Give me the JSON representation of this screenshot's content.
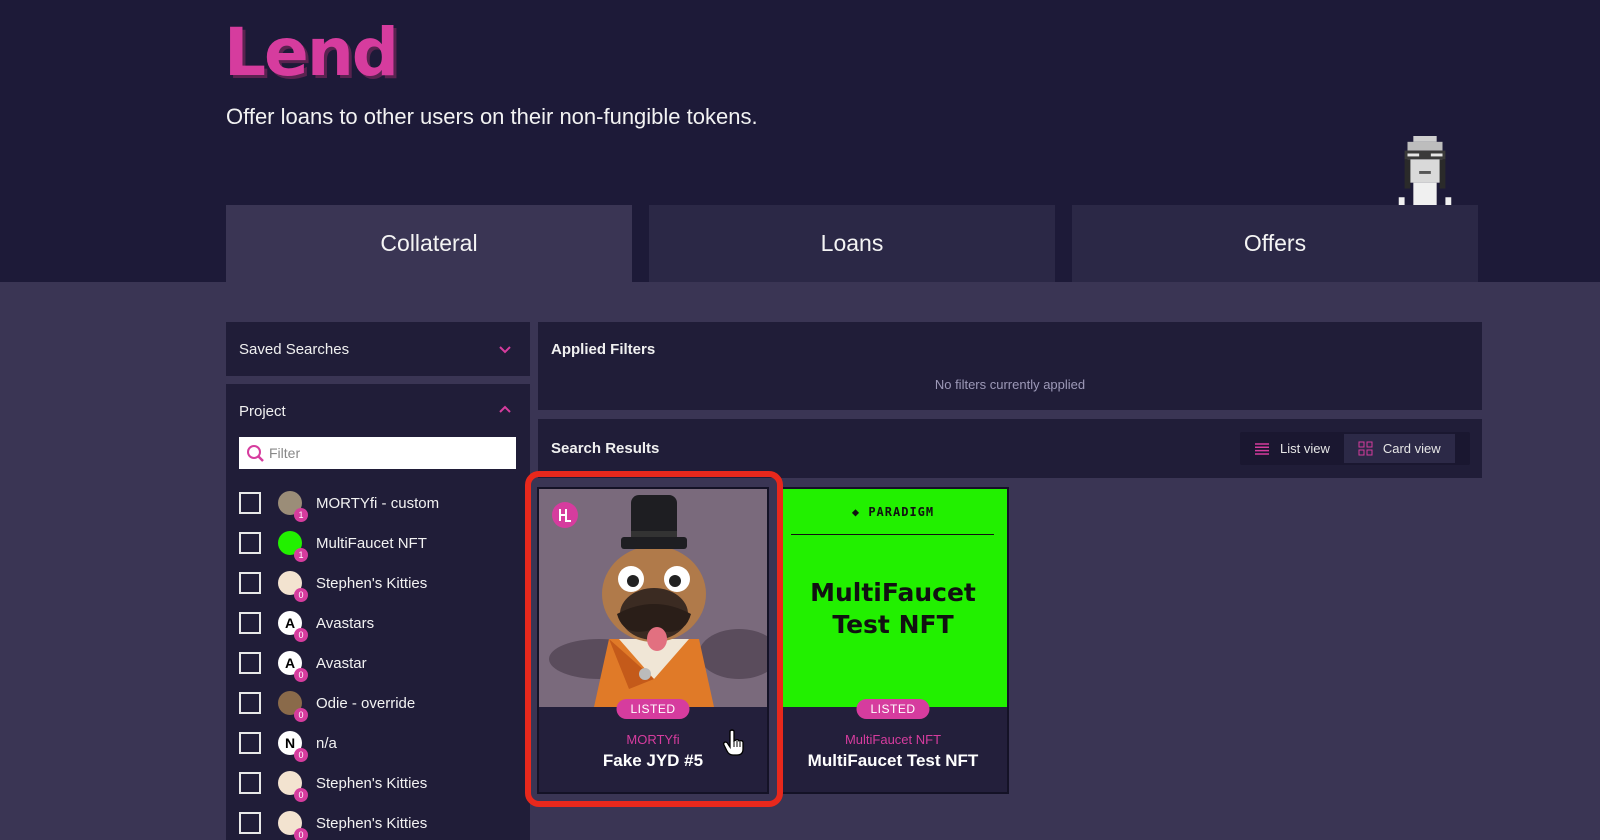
{
  "header": {
    "title": "Lend",
    "subtitle": "Offer loans to other users on their non-fungible tokens."
  },
  "tabs": [
    {
      "label": "Collateral",
      "active": true
    },
    {
      "label": "Loans",
      "active": false
    },
    {
      "label": "Offers",
      "active": false
    }
  ],
  "sidebar": {
    "saved_searches_label": "Saved Searches",
    "project_label": "Project",
    "filter_placeholder": "Filter",
    "projects": [
      {
        "label": "MORTYfi - custom",
        "count": "1",
        "icon": "avatar-photo"
      },
      {
        "label": "MultiFaucet NFT",
        "count": "1",
        "icon": "green-logo"
      },
      {
        "label": "Stephen's Kitties",
        "count": "0",
        "icon": "kitty-avatar"
      },
      {
        "label": "Avastars",
        "count": "0",
        "icon": "A"
      },
      {
        "label": "Avastar",
        "count": "0",
        "icon": "A"
      },
      {
        "label": "Odie - override",
        "count": "0",
        "icon": "avatar-photo"
      },
      {
        "label": "n/a",
        "count": "0",
        "icon": "N"
      },
      {
        "label": "Stephen's Kitties",
        "count": "0",
        "icon": "kitty-avatar"
      },
      {
        "label": "Stephen's Kitties",
        "count": "0",
        "icon": "kitty-avatar"
      }
    ]
  },
  "applied_filters": {
    "title": "Applied Filters",
    "empty_text": "No filters currently applied"
  },
  "results": {
    "title": "Search Results",
    "list_view_label": "List view",
    "card_view_label": "Card view",
    "active_view": "card",
    "cards": [
      {
        "project": "MORTYfi",
        "name": "Fake JYD #5",
        "badge": "LISTED"
      },
      {
        "project": "MultiFaucet NFT",
        "name": "MultiFaucet Test NFT",
        "badge": "LISTED",
        "image_brand": "PARADIGM",
        "image_text_line1": "MultiFaucet",
        "image_text_line2": "Test NFT"
      }
    ]
  },
  "colors": {
    "accent": "#d63c9e",
    "header_bg": "#1d1a38",
    "body_bg": "#3a3554",
    "panel_bg": "#201d38",
    "highlight": "#e8281c",
    "nft_green": "#22f000"
  }
}
